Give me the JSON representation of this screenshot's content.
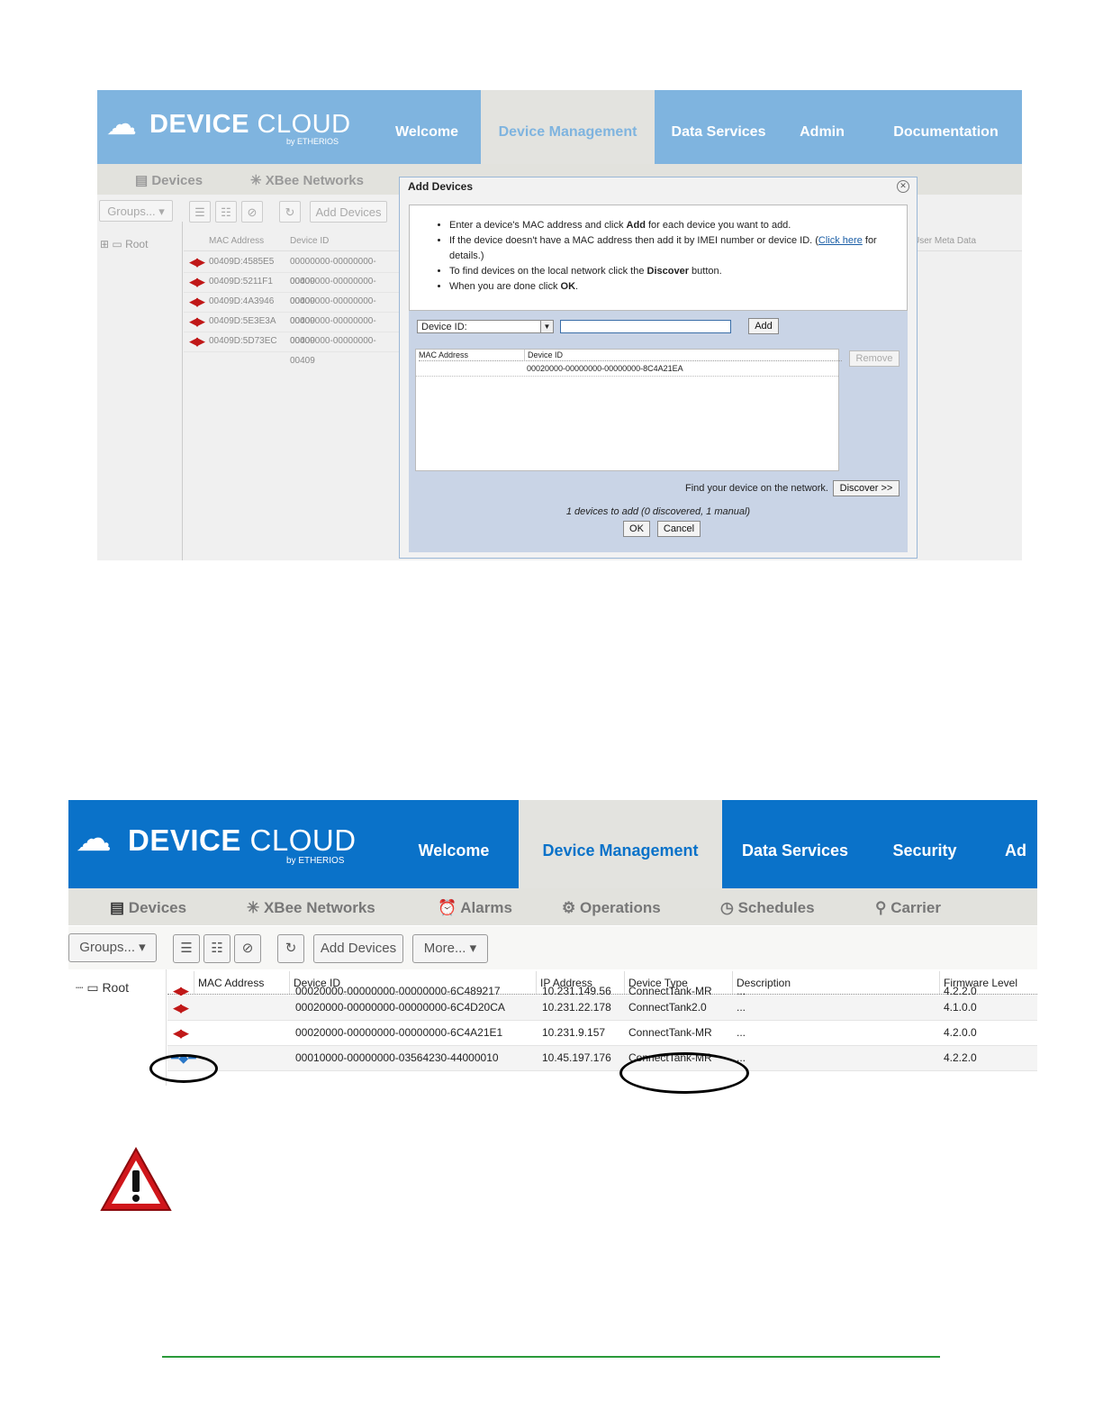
{
  "shot1": {
    "logo": {
      "text_a": "DEVICE",
      "text_b": "CLOUD",
      "by": "by ETHERIOS"
    },
    "nav": [
      "Welcome",
      "Device Management",
      "Data Services",
      "Admin",
      "Documentation"
    ],
    "subnav": {
      "devices": "Devices",
      "xbee": "XBee Networks"
    },
    "toolbar": {
      "groups": "Groups...",
      "add_devices": "Add Devices"
    },
    "tree_root": "Root",
    "grid": {
      "headers": [
        "MAC Address",
        "Device ID"
      ],
      "user_meta_header": "User Meta Data",
      "rows": [
        {
          "mac": "00409D:4585E5",
          "id": "00000000-00000000-00409"
        },
        {
          "mac": "00409D:5211F1",
          "id": "00000000-00000000-00409"
        },
        {
          "mac": "00409D:4A3946",
          "id": "00000000-00000000-00409"
        },
        {
          "mac": "00409D:5E3E3A",
          "id": "00000000-00000000-00409"
        },
        {
          "mac": "00409D:5D73EC",
          "id": "00000000-00000000-00409"
        }
      ]
    },
    "dialog": {
      "title": "Add Devices",
      "instr1_a": "Enter a device's MAC address and click ",
      "instr1_b": "Add",
      "instr1_c": " for each device you want to add.",
      "instr2_a": "If the device doesn't have a MAC address then add it by IMEI number or device ID. (",
      "instr2_link": "Click here",
      "instr2_b": " for details.)",
      "instr3_a": "To find devices on the local network click the ",
      "instr3_b": "Discover",
      "instr3_c": " button.",
      "instr4_a": "When you are done click ",
      "instr4_b": "OK",
      "instr4_c": ".",
      "select_value": "Device ID:",
      "add_button": "Add",
      "table_headers": [
        "MAC Address",
        "Device ID"
      ],
      "table_row": {
        "mac": "",
        "id": "00020000-00000000-00000000-8C4A21EA"
      },
      "remove_button": "Remove",
      "discover_label": "Find your device on the network.",
      "discover_button": "Discover >>",
      "status": "1 devices to add (0 discovered, 1 manual)",
      "ok_button": "OK",
      "cancel_button": "Cancel"
    }
  },
  "shot2": {
    "logo": {
      "text_a": "DEVICE",
      "text_b": "CLOUD",
      "by": "by ETHERIOS"
    },
    "nav": [
      "Welcome",
      "Device Management",
      "Data Services",
      "Security",
      "Ad"
    ],
    "subnav": [
      "Devices",
      "XBee Networks",
      "Alarms",
      "Operations",
      "Schedules",
      "Carrier"
    ],
    "toolbar": {
      "groups": "Groups...",
      "add_devices": "Add Devices",
      "more": "More..."
    },
    "tree_root": "Root",
    "grid": {
      "headers": [
        "MAC Address",
        "Device ID",
        "IP Address",
        "Device Type",
        "Description",
        "Firmware Level"
      ],
      "rows": [
        {
          "id": "00020000-00000000-00000000-6C489217",
          "ip": "10.231.149.56",
          "type": "ConnectTank-MR",
          "desc": "...",
          "fw": "4.2.2.0",
          "icon": "red"
        },
        {
          "id": "00020000-00000000-00000000-6C4D20CA",
          "ip": "10.231.22.178",
          "type": "ConnectTank2.0",
          "desc": "...",
          "fw": "4.1.0.0",
          "icon": "red"
        },
        {
          "id": "00020000-00000000-00000000-6C4A21E1",
          "ip": "10.231.9.157",
          "type": "ConnectTank-MR",
          "desc": "...",
          "fw": "4.2.0.0",
          "icon": "red"
        },
        {
          "id": "00010000-00000000-03564230-44000010",
          "ip": "10.45.197.176",
          "type": "ConnectTank-MR",
          "desc": "...",
          "fw": "4.2.2.0",
          "icon": "blue"
        }
      ]
    }
  },
  "colors": {
    "header_faded": "#7fb4df",
    "header_active": "#0a72c9",
    "footer_line": "#2a9a3a",
    "warning_red": "#d0161b"
  }
}
